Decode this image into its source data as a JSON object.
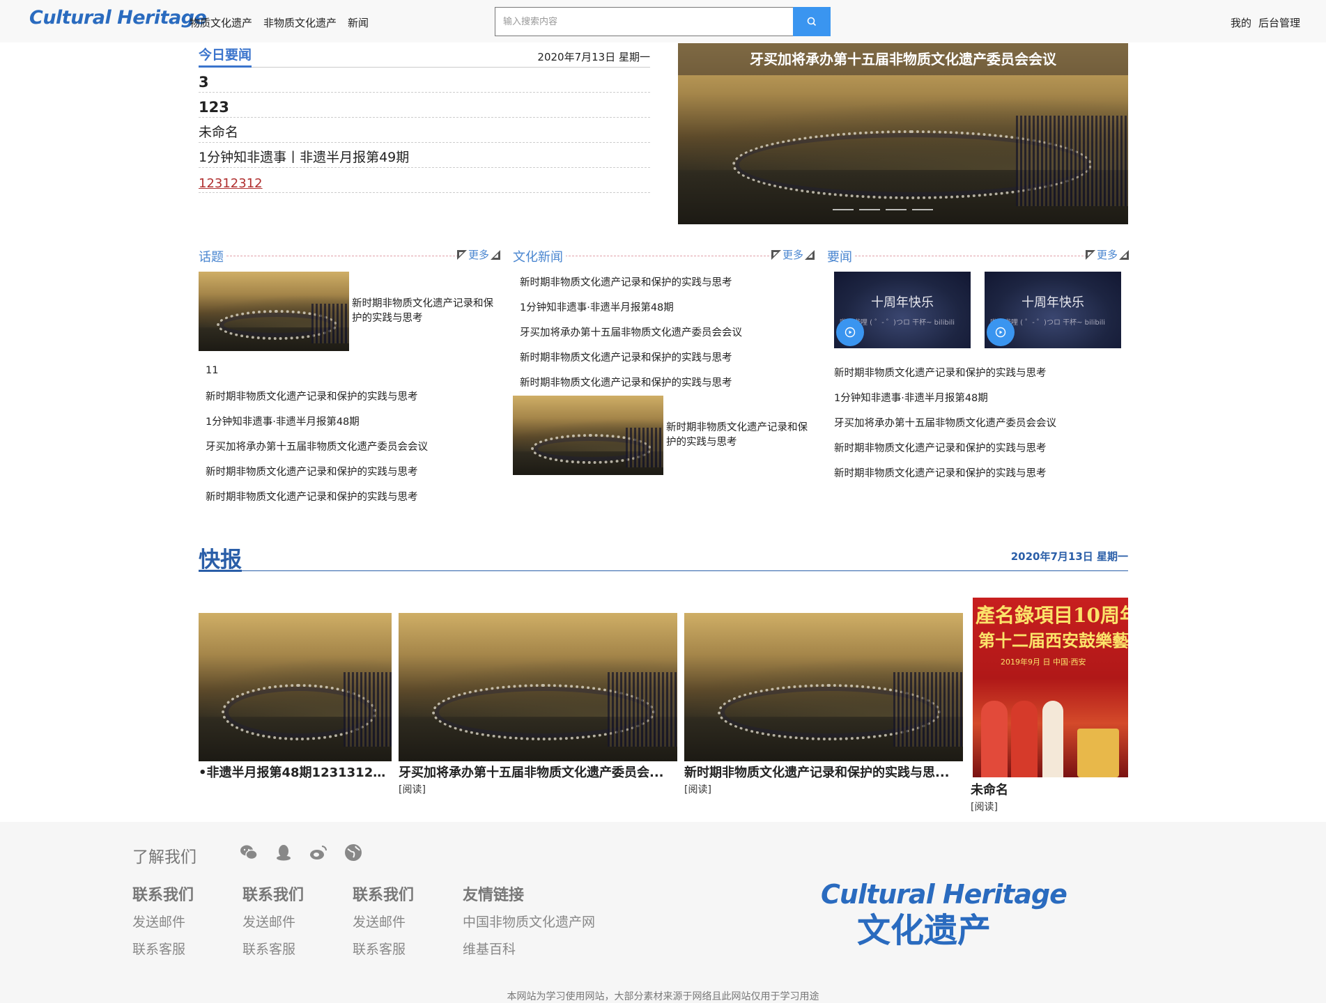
{
  "header": {
    "brand": "Cultural Heritage",
    "nav": [
      "物质文化遗产",
      "非物质文化遗产",
      "新闻"
    ],
    "search_placeholder": "输入搜索内容",
    "user_links": [
      "我的",
      "后台管理"
    ]
  },
  "today": {
    "title": "今日要闻",
    "date": "2020年7月13日 星期一",
    "items": [
      "3",
      "123",
      "未命名",
      "1分钟知非遗事丨非遗半月报第49期",
      "12312312"
    ]
  },
  "carousel": {
    "caption": "牙买加将承办第十五届非物质文化遗产委员会会议"
  },
  "sections": {
    "topics": {
      "title": "话题",
      "more": "更多",
      "feature_text": "新时期非物质文化遗产记录和保护的实践与思考",
      "items": [
        "11",
        "新时期非物质文化遗产记录和保护的实践与思考",
        "1分钟知非遗事·非遗半月报第48期",
        "牙买加将承办第十五届非物质文化遗产委员会会议",
        "新时期非物质文化遗产记录和保护的实践与思考",
        "新时期非物质文化遗产记录和保护的实践与思考"
      ]
    },
    "culture": {
      "title": "文化新闻",
      "more": "更多",
      "items": [
        "新时期非物质文化遗产记录和保护的实践与思考",
        "1分钟知非遗事·非遗半月报第48期",
        "牙买加将承办第十五届非物质文化遗产委员会会议",
        "新时期非物质文化遗产记录和保护的实践与思考",
        "新时期非物质文化遗产记录和保护的实践与思考"
      ],
      "feature_text": "新时期非物质文化遗产记录和保护的实践与思考"
    },
    "important": {
      "title": "要闻",
      "more": "更多",
      "videos": [
        {
          "title": "十周年快乐",
          "sub": "哔哩哔哩 ( ゜- ゜)つロ 干杯~ bilibili"
        },
        {
          "title": "十周年快乐",
          "sub": "哔哩哔哩 ( ゜- ゜)つロ 干杯~ bilibili"
        }
      ],
      "items": [
        "新时期非物质文化遗产记录和保护的实践与思考",
        "1分钟知非遗事·非遗半月报第48期",
        "牙买加将承办第十五届非物质文化遗产委员会会议",
        "新时期非物质文化遗产记录和保护的实践与思考",
        "新时期非物质文化遗产记录和保护的实践与思考"
      ]
    }
  },
  "flash": {
    "title": "快报",
    "date": "2020年7月13日 星期一",
    "cards": [
      {
        "title": "•非遗半月报第48期12313123...",
        "read": ""
      },
      {
        "title": "牙买加将承办第十五届非物质文化遗产委员会...",
        "read": "[阅读]"
      },
      {
        "title": "新时期非物质文化遗产记录和保护的实践与思...",
        "read": "[阅读]"
      },
      {
        "title": "未命名",
        "read": "[阅读]"
      }
    ],
    "poster": {
      "line1": "產名錄項目10周年",
      "line2": "第十二届西安鼓樂藝",
      "line3": "2019年9月 日  中国·西安"
    }
  },
  "footer": {
    "about": "了解我们",
    "columns": [
      {
        "heading": "联系我们",
        "links": [
          "发送邮件",
          "联系客服"
        ]
      },
      {
        "heading": "联系我们",
        "links": [
          "发送邮件",
          "联系客服"
        ]
      },
      {
        "heading": "联系我们",
        "links": [
          "发送邮件",
          "联系客服"
        ]
      },
      {
        "heading": "友情链接",
        "links": [
          "中国非物质文化遗产网",
          "维基百科"
        ]
      }
    ],
    "logo_en": "Cultural Heritage",
    "logo_cn": "文化遗产",
    "copyright": "本网站为学习使用网站，大部分素材来源于网络且此网站仅用于学习用途"
  },
  "colors": {
    "accent": "#3b74cc",
    "search_button": "#3a95f0",
    "flash_blue": "#2a5ea8",
    "link_red": "#b03030"
  },
  "icons": [
    "search-icon",
    "wechat-icon",
    "qq-icon",
    "weibo-icon",
    "globe-icon",
    "play-icon"
  ]
}
